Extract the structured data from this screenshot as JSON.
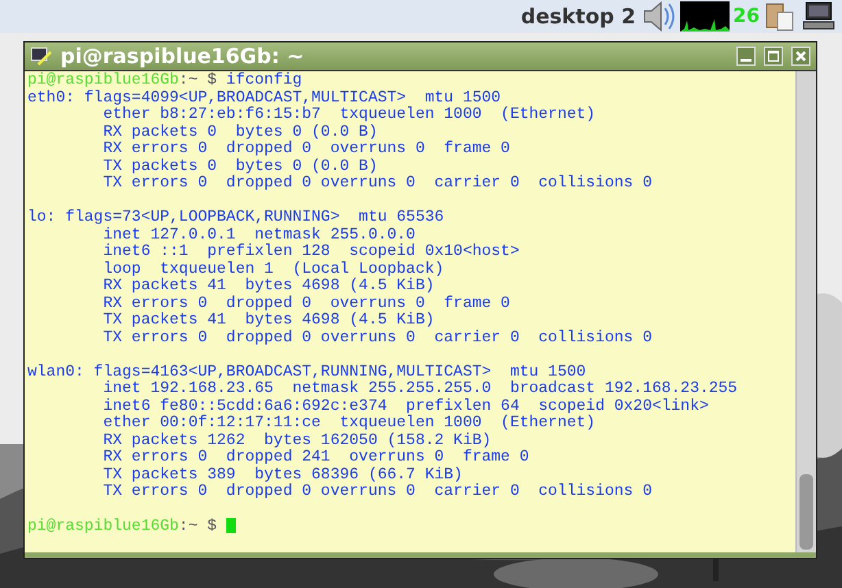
{
  "panel": {
    "desktop_label": "desktop 2",
    "cpu_reading": "26"
  },
  "window": {
    "title": "pi@raspiblue16Gb: ~"
  },
  "terminal": {
    "lines": [
      {
        "kind": "prompt",
        "user_host": "pi@raspiblue16Gb",
        "path": ":~ $",
        "command": "ifconfig"
      },
      {
        "kind": "output",
        "text": "eth0: flags=4099<UP,BROADCAST,MULTICAST>  mtu 1500"
      },
      {
        "kind": "output",
        "text": "        ether b8:27:eb:f6:15:b7  txqueuelen 1000  (Ethernet)"
      },
      {
        "kind": "output",
        "text": "        RX packets 0  bytes 0 (0.0 B)"
      },
      {
        "kind": "output",
        "text": "        RX errors 0  dropped 0  overruns 0  frame 0"
      },
      {
        "kind": "output",
        "text": "        TX packets 0  bytes 0 (0.0 B)"
      },
      {
        "kind": "output",
        "text": "        TX errors 0  dropped 0 overruns 0  carrier 0  collisions 0"
      },
      {
        "kind": "blank"
      },
      {
        "kind": "output",
        "text": "lo: flags=73<UP,LOOPBACK,RUNNING>  mtu 65536"
      },
      {
        "kind": "output",
        "text": "        inet 127.0.0.1  netmask 255.0.0.0"
      },
      {
        "kind": "output",
        "text": "        inet6 ::1  prefixlen 128  scopeid 0x10<host>"
      },
      {
        "kind": "output",
        "text": "        loop  txqueuelen 1  (Local Loopback)"
      },
      {
        "kind": "output",
        "text": "        RX packets 41  bytes 4698 (4.5 KiB)"
      },
      {
        "kind": "output",
        "text": "        RX errors 0  dropped 0  overruns 0  frame 0"
      },
      {
        "kind": "output",
        "text": "        TX packets 41  bytes 4698 (4.5 KiB)"
      },
      {
        "kind": "output",
        "text": "        TX errors 0  dropped 0 overruns 0  carrier 0  collisions 0"
      },
      {
        "kind": "blank"
      },
      {
        "kind": "output",
        "text": "wlan0: flags=4163<UP,BROADCAST,RUNNING,MULTICAST>  mtu 1500"
      },
      {
        "kind": "output",
        "text": "        inet 192.168.23.65  netmask 255.255.255.0  broadcast 192.168.23.255"
      },
      {
        "kind": "output",
        "text": "        inet6 fe80::5cdd:6a6:692c:e374  prefixlen 64  scopeid 0x20<link>"
      },
      {
        "kind": "output",
        "text": "        ether 00:0f:12:17:11:ce  txqueuelen 1000  (Ethernet)"
      },
      {
        "kind": "output",
        "text": "        RX packets 1262  bytes 162050 (158.2 KiB)"
      },
      {
        "kind": "output",
        "text": "        RX errors 0  dropped 241  overruns 0  frame 0"
      },
      {
        "kind": "output",
        "text": "        TX packets 389  bytes 68396 (66.7 KiB)"
      },
      {
        "kind": "output",
        "text": "        TX errors 0  dropped 0 overruns 0  carrier 0  collisions 0"
      },
      {
        "kind": "blank"
      },
      {
        "kind": "prompt",
        "user_host": "pi@raspiblue16Gb",
        "path": ":~ $",
        "cursor": true
      }
    ]
  }
}
